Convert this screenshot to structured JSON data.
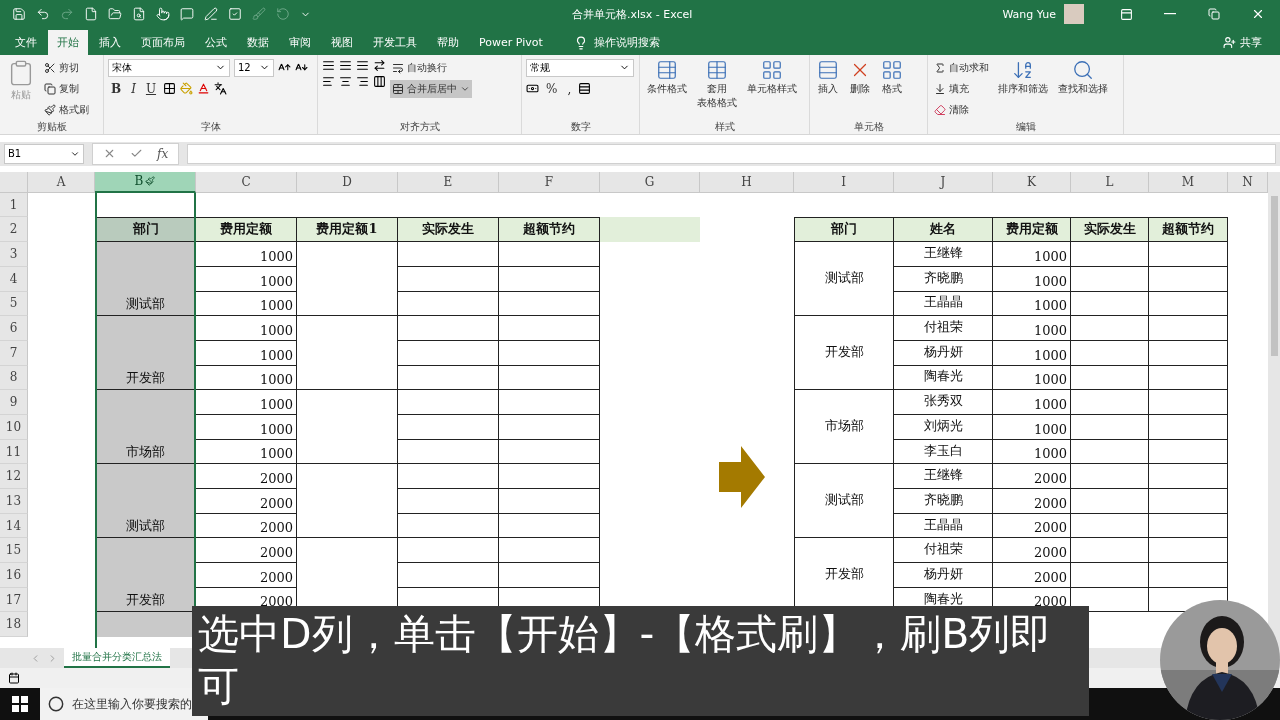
{
  "title_bar": {
    "title": "合并单元格.xlsx  -  Excel",
    "user": "Wang Yue"
  },
  "ribbon_tabs": [
    {
      "label": "文件",
      "selected": false
    },
    {
      "label": "开始",
      "selected": true
    },
    {
      "label": "插入",
      "selected": false
    },
    {
      "label": "页面布局",
      "selected": false
    },
    {
      "label": "公式",
      "selected": false
    },
    {
      "label": "数据",
      "selected": false
    },
    {
      "label": "审阅",
      "selected": false
    },
    {
      "label": "视图",
      "selected": false
    },
    {
      "label": "开发工具",
      "selected": false
    },
    {
      "label": "帮助",
      "selected": false
    },
    {
      "label": "Power Pivot",
      "selected": false
    }
  ],
  "tell_me": "操作说明搜索",
  "share": "共享",
  "clipboard": {
    "paste": "粘贴",
    "items": [
      "剪切",
      "复制",
      "格式刷"
    ],
    "label": "剪贴板"
  },
  "font": {
    "name": "宋体",
    "size": "12",
    "styles": [
      "B",
      "I",
      "U"
    ],
    "label": "字体"
  },
  "alignment": {
    "wrap": "自动换行",
    "merge": "合并后居中",
    "label": "对齐方式"
  },
  "number": {
    "format": "常规",
    "symbols": [
      "%",
      ","
    ],
    "label": "数字"
  },
  "styles": {
    "buttons": [
      [
        "条件格式"
      ],
      [
        "套用",
        "表格格式"
      ],
      [
        "单元格样式"
      ]
    ],
    "label": "样式"
  },
  "cells": {
    "buttons": [
      "插入",
      "删除",
      "格式"
    ],
    "label": "单元格"
  },
  "editing": {
    "items": [
      "自动求和",
      "填充",
      "清除"
    ],
    "buttons": [
      "排序和筛选",
      "查找和选择"
    ],
    "label": "编辑"
  },
  "formula_bar": {
    "name_box": "B1",
    "function_symbol": "fx"
  },
  "columns": [
    {
      "label": "A",
      "selected": false
    },
    {
      "label": "B",
      "selected": true
    },
    {
      "label": "C",
      "selected": false
    },
    {
      "label": "D",
      "selected": false
    },
    {
      "label": "E",
      "selected": false
    },
    {
      "label": "F",
      "selected": false
    },
    {
      "label": "G",
      "selected": false
    },
    {
      "label": "H",
      "selected": false
    },
    {
      "label": "I",
      "selected": false
    },
    {
      "label": "J",
      "selected": false
    },
    {
      "label": "K",
      "selected": false
    },
    {
      "label": "L",
      "selected": false
    },
    {
      "label": "M",
      "selected": false
    },
    {
      "label": "N",
      "selected": false
    }
  ],
  "row_numbers": [
    "1",
    "2",
    "3",
    "4",
    "5",
    "6",
    "7",
    "8",
    "9",
    "10",
    "11",
    "12",
    "13",
    "14",
    "15",
    "16",
    "17",
    "18"
  ],
  "left_table": {
    "headers": [
      "部门",
      "费用定额",
      "费用定额1",
      "实际发生",
      "超额节约"
    ],
    "groups": [
      {
        "department": "测试部",
        "amounts": [
          "1000",
          "1000",
          "1000"
        ]
      },
      {
        "department": "开发部",
        "amounts": [
          "1000",
          "1000",
          "1000"
        ]
      },
      {
        "department": "市场部",
        "amounts": [
          "1000",
          "1000",
          "1000"
        ]
      },
      {
        "department": "测试部",
        "amounts": [
          "2000",
          "2000",
          "2000"
        ]
      },
      {
        "department": "开发部",
        "amounts": [
          "2000",
          "2000",
          "2000"
        ]
      }
    ]
  },
  "right_table": {
    "headers": [
      "部门",
      "姓名",
      "费用定额",
      "实际发生",
      "超额节约"
    ],
    "groups": [
      {
        "department": "测试部",
        "rows": [
          {
            "name": "王继锋",
            "amount": "1000"
          },
          {
            "name": "齐晓鹏",
            "amount": "1000"
          },
          {
            "name": "王晶晶",
            "amount": "1000"
          }
        ]
      },
      {
        "department": "开发部",
        "rows": [
          {
            "name": "付祖荣",
            "amount": "1000"
          },
          {
            "name": "杨丹妍",
            "amount": "1000"
          },
          {
            "name": "陶春光",
            "amount": "1000"
          }
        ]
      },
      {
        "department": "市场部",
        "rows": [
          {
            "name": "张秀双",
            "amount": "1000"
          },
          {
            "name": "刘炳光",
            "amount": "1000"
          },
          {
            "name": "李玉白",
            "amount": "1000"
          }
        ]
      },
      {
        "department": "测试部",
        "rows": [
          {
            "name": "王继锋",
            "amount": "2000"
          },
          {
            "name": "齐晓鹏",
            "amount": "2000"
          },
          {
            "name": "王晶晶",
            "amount": "2000"
          }
        ]
      },
      {
        "department": "开发部",
        "rows": [
          {
            "name": "付祖荣",
            "amount": "2000"
          },
          {
            "name": "杨丹妍",
            "amount": "2000"
          },
          {
            "name": "陶春光",
            "amount": "2000"
          }
        ]
      }
    ]
  },
  "sheet_tabs": [
    {
      "label": "批量合并分类汇总法",
      "selected": true
    }
  ],
  "taskbar": {
    "search_placeholder": "在这里输入你要搜索的"
  },
  "subtitle": "选中D列，单击【开始】-【格式刷】，刷B列即可"
}
